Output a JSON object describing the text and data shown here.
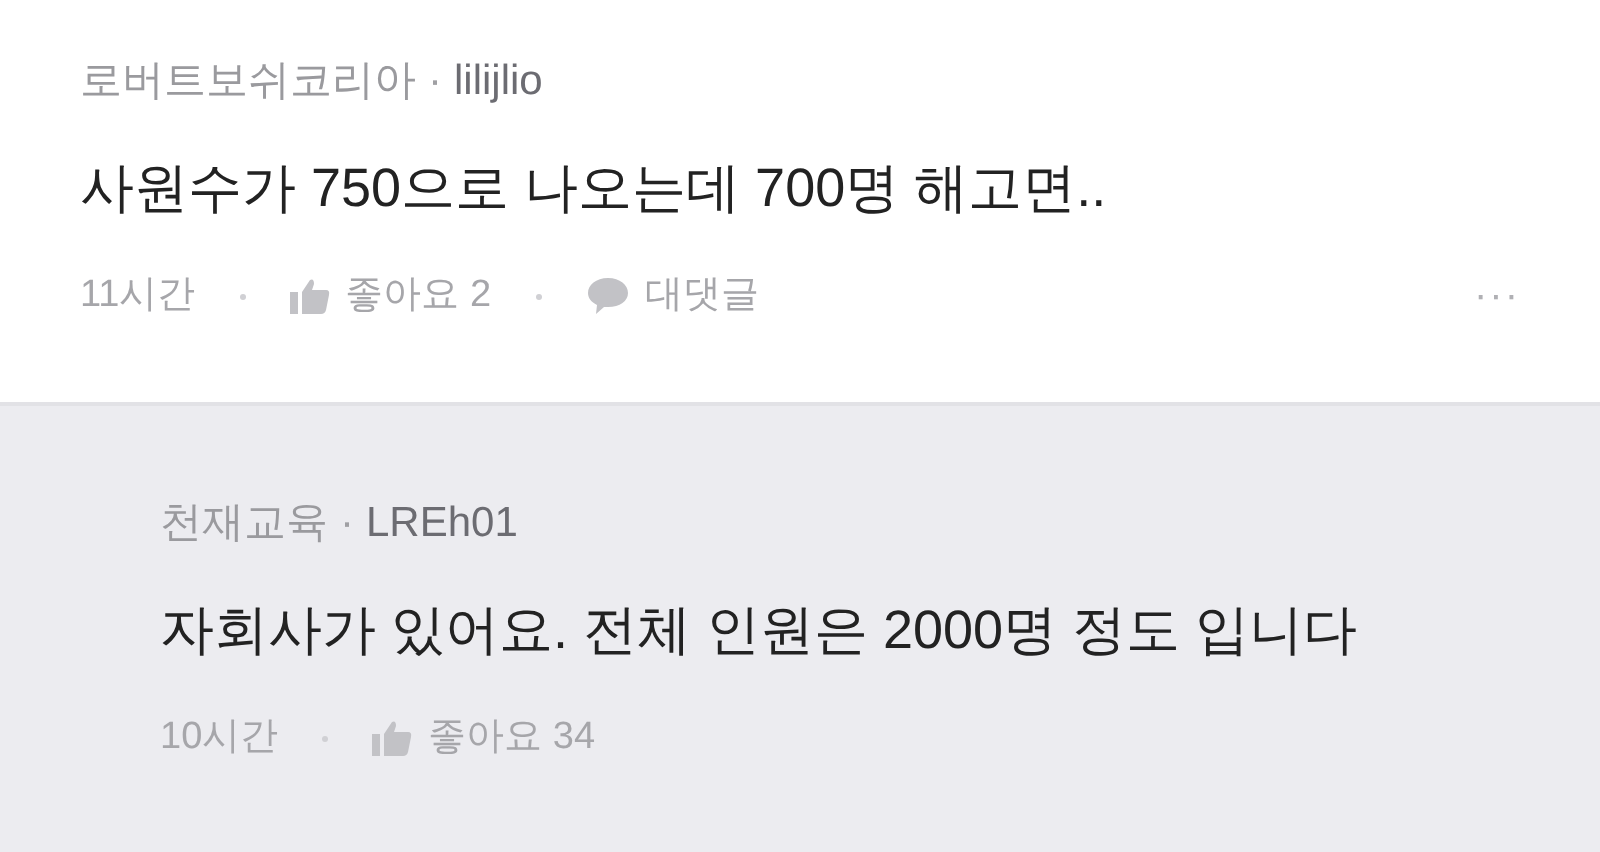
{
  "comments": [
    {
      "kind": "comment",
      "company": "로버트보쉬코리아",
      "separator": "·",
      "author": "lilijlio",
      "text": "사원수가 750으로 나오는데 700명 해고면..",
      "time": "11시간",
      "likes": "좋아요 2",
      "reply_label": "대댓글",
      "more": "···"
    },
    {
      "kind": "reply",
      "company": "천재교육",
      "separator": "·",
      "author": "LREh01",
      "text": "자회사가 있어요. 전체 인원은 2000명 정도 입니다",
      "time": "10시간",
      "likes": "좋아요 34"
    }
  ]
}
